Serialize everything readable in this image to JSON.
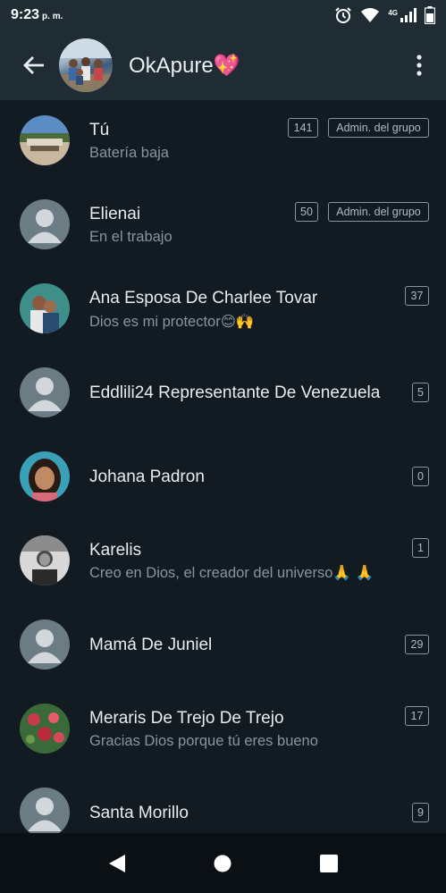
{
  "status": {
    "time": "9:23",
    "ampm": "p. m.",
    "network": "4G"
  },
  "header": {
    "title": "OkApure💖"
  },
  "members": [
    {
      "name": "Tú",
      "about": "Batería baja",
      "count": "141",
      "admin": "Admin. del grupo",
      "avatar": "photo-landscape"
    },
    {
      "name": "Elienai",
      "about": "En el trabajo",
      "count": "50",
      "admin": "Admin. del grupo",
      "avatar": "default"
    },
    {
      "name": "Ana Esposa De Charlee Tovar",
      "about": "Dios es mi protector😊🙌",
      "count": "37",
      "admin": "",
      "avatar": "photo-couple"
    },
    {
      "name": "Eddlili24 Representante De Venezuela",
      "about": "",
      "count": "5",
      "admin": "",
      "avatar": "default"
    },
    {
      "name": "Johana Padron",
      "about": "",
      "count": "0",
      "admin": "",
      "avatar": "photo-woman"
    },
    {
      "name": "Karelis",
      "about": "Creo en Dios, el creador del universo🙏 🙏",
      "count": "1",
      "admin": "",
      "avatar": "photo-woman-bw"
    },
    {
      "name": "Mamá De Juniel",
      "about": "",
      "count": "29",
      "admin": "",
      "avatar": "default"
    },
    {
      "name": "Meraris De Trejo De Trejo",
      "about": "Gracias Dios porque tú eres bueno",
      "count": "17",
      "admin": "",
      "avatar": "photo-flowers"
    },
    {
      "name": "Santa Morillo",
      "about": "",
      "count": "9",
      "admin": "",
      "avatar": "default"
    }
  ],
  "colors": {
    "background": "#121b22",
    "appbar": "#1f2c34",
    "primary_text": "#e9edef",
    "secondary_text": "#8696a0"
  }
}
